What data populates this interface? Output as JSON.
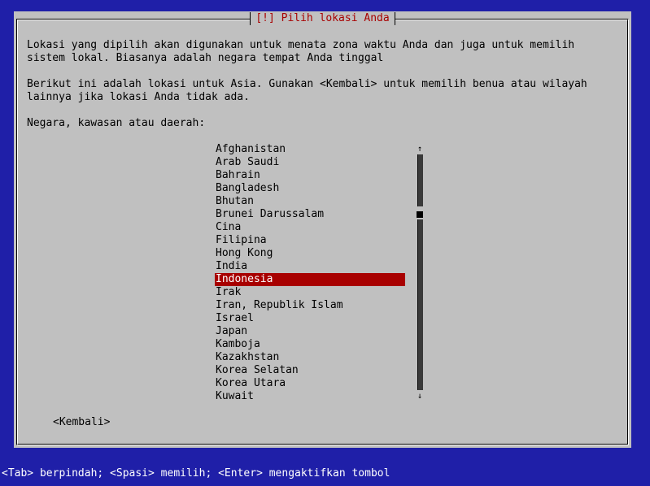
{
  "dialog": {
    "title": "[!] Pilih lokasi Anda",
    "paragraph1": [
      "Lokasi yang dipilih akan digunakan untuk menata zona waktu Anda dan juga untuk memilih",
      "sistem lokal. Biasanya adalah negara tempat Anda tinggal"
    ],
    "paragraph2": [
      "Berikut ini adalah lokasi untuk Asia. Gunakan <Kembali> untuk memilih benua atau wilayah",
      "lainnya jika lokasi Anda tidak ada."
    ],
    "prompt": "Negara, kawasan atau daerah:",
    "countries": [
      "Afghanistan",
      "Arab Saudi",
      "Bahrain",
      "Bangladesh",
      "Bhutan",
      "Brunei Darussalam",
      "Cina",
      "Filipina",
      "Hong Kong",
      "India",
      "Indonesia",
      "Irak",
      "Iran, Republik Islam",
      "Israel",
      "Japan",
      "Kamboja",
      "Kazakhstan",
      "Korea Selatan",
      "Korea Utara",
      "Kuwait"
    ],
    "selected_index": 10,
    "back_button": "<Kembali>",
    "scroll_up": "↑",
    "scroll_down": "↓"
  },
  "status_bar": "<Tab> berpindah; <Spasi> memilih; <Enter> mengaktifkan tombol",
  "colors": {
    "background": "#1f1fa8",
    "dialog": "#c0c0c0",
    "title": "#a80000",
    "selection": "#a80000"
  }
}
